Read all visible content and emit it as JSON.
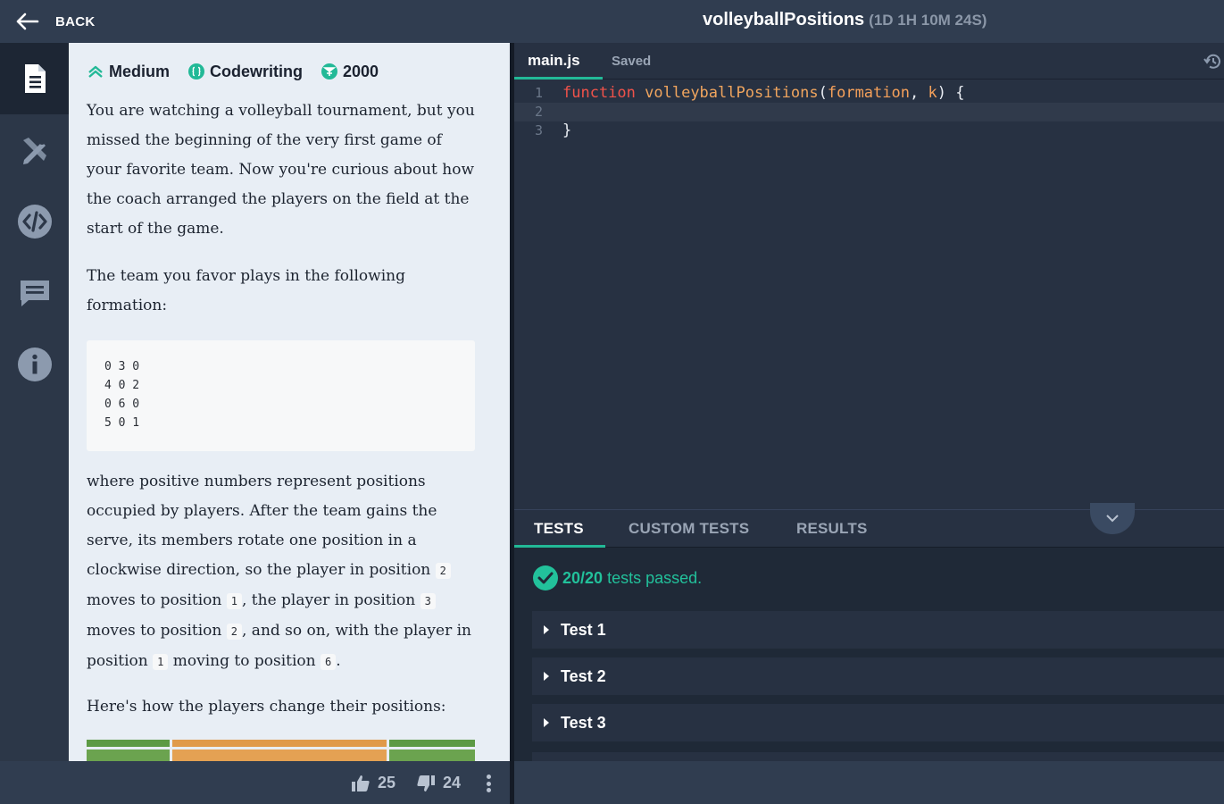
{
  "header": {
    "back_label": "BACK",
    "title": "volleyballPositions",
    "timer": "(1D 1H 10M 24S)"
  },
  "nav": {
    "items": [
      "description-icon",
      "solutions-icon",
      "code-icon",
      "comments-icon",
      "info-icon"
    ],
    "active": "description-icon"
  },
  "task": {
    "difficulty": "Medium",
    "type": "Codewriting",
    "points": "2000",
    "p1": "You are watching a volleyball tournament, but you missed the beginning of the very first game of your favorite team. Now you're curious about how the coach arranged the players on the field at the start of the game.",
    "p2": "The team you favor plays in the following formation:",
    "formation_block": "0 3 0\n4 0 2\n0 6 0\n5 0 1",
    "p3": {
      "t1": "where positive numbers represent positions occupied by players. After the team gains the serve, its members rotate one position in a clockwise direction, so the player in position",
      "c1": "2",
      "t2": "moves to position",
      "c2": "1",
      "t3": ", the player in position",
      "c3": "3",
      "t4": "moves to position",
      "c4": "2",
      "t5": ", and so on, with the player in position",
      "c5": "1",
      "t6": "moving to position",
      "c6": "6",
      "t7": "."
    },
    "p4": "Here's how the players change their positions:",
    "court_colors": [
      "#6ba34f",
      "#e4a153",
      "#6ba34f"
    ]
  },
  "footer": {
    "likes": "25",
    "dislikes": "24"
  },
  "editor": {
    "file_tab": "main.js",
    "status": "Saved",
    "lines": [
      {
        "num": "1",
        "kw": "function",
        "fn": "volleyballPositions",
        "p1": "formation",
        "p2": "k"
      },
      {
        "num": "2"
      },
      {
        "num": "3",
        "text": "}"
      }
    ]
  },
  "tests": {
    "tabs": [
      "TESTS",
      "CUSTOM TESTS",
      "RESULTS"
    ],
    "active_tab": "TESTS",
    "summary_count": "20/20",
    "summary_text": "tests passed.",
    "items": [
      "Test 1",
      "Test 2",
      "Test 3"
    ],
    "accent_color": "#22c19b"
  }
}
